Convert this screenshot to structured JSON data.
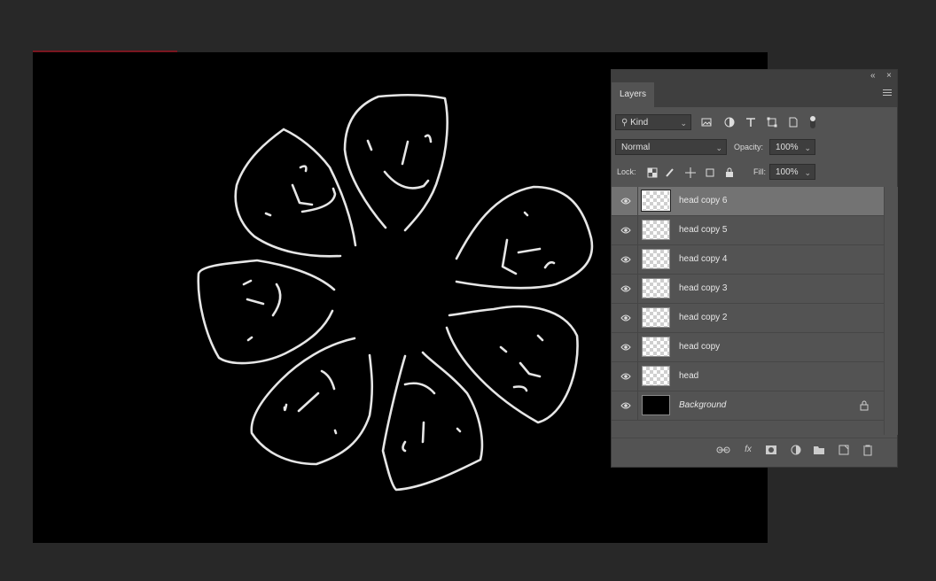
{
  "panel": {
    "collapse_label": "«",
    "close_label": "×",
    "tab_label": "Layers",
    "filter": {
      "kind_label": "Kind"
    },
    "blend_mode": "Normal",
    "opacity_label": "Opacity:",
    "opacity_value": "100%",
    "lock_label": "Lock:",
    "fill_label": "Fill:",
    "fill_value": "100%",
    "layers": [
      {
        "name": "head copy 6",
        "visible": true,
        "selected": true
      },
      {
        "name": "head copy 5",
        "visible": true
      },
      {
        "name": "head copy 4",
        "visible": true
      },
      {
        "name": "head copy 3",
        "visible": true
      },
      {
        "name": "head copy 2",
        "visible": true
      },
      {
        "name": "head copy",
        "visible": true
      },
      {
        "name": "head",
        "visible": true
      },
      {
        "name": "Background",
        "visible": true,
        "locked": true
      }
    ],
    "footer_buttons": [
      "link-icon",
      "fx-icon",
      "mask-icon",
      "adjustment-icon",
      "folder-icon",
      "new-layer-icon",
      "trash-icon"
    ],
    "fx_label": "fx"
  },
  "colors": {
    "app_background": "#282828",
    "canvas": "#000000",
    "panel": "#535353",
    "selected_layer": "#737373",
    "stroke": "#e8e8e8"
  }
}
